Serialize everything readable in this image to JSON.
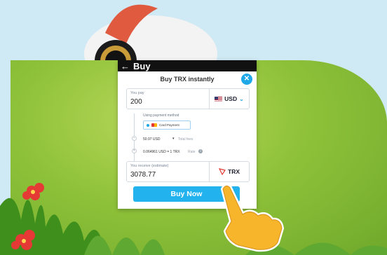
{
  "header": {
    "back_icon": "arrow-left-icon",
    "title": "Buy"
  },
  "modal": {
    "title": "Buy TRX instantly",
    "close_icon": "close-icon",
    "you_pay": {
      "label": "You pay",
      "value": "200",
      "currency": "USD",
      "flag_icon": "us-flag-icon",
      "chevron_icon": "chevron-down-icon"
    },
    "payment": {
      "label": "Using payment method",
      "method": "Card Payment",
      "card_icon": "card-icon"
    },
    "fees": {
      "value": "50.97 USD",
      "label": "Total fees",
      "rate": "0.064961 USD = 1 TRX",
      "rate_label": "Rate",
      "info_icon": "info-icon"
    },
    "you_receive": {
      "label": "You receive (estimate)",
      "value": "3078.77",
      "currency": "TRX",
      "trx_icon": "tron-logo-icon"
    },
    "buy_button": "Buy Now"
  },
  "colors": {
    "accent": "#22b2ee",
    "grass": "#8fc23a",
    "sky": "#cfe9f5"
  }
}
